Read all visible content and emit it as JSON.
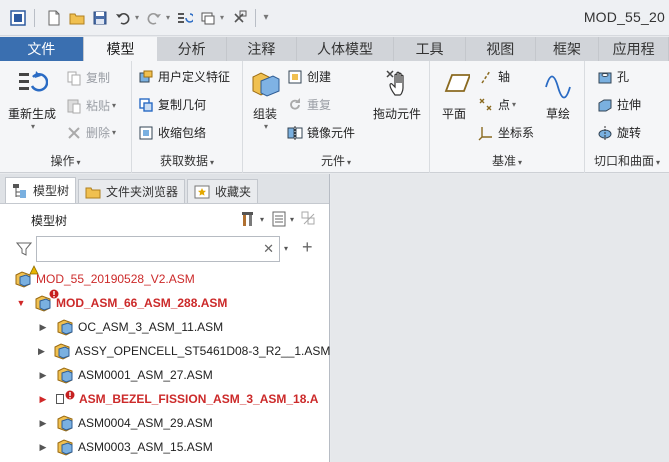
{
  "window": {
    "title": "MOD_55_20"
  },
  "tabs": [
    {
      "label": "文件",
      "w": 84
    },
    {
      "label": "模型",
      "w": 74
    },
    {
      "label": "分析",
      "w": 70
    },
    {
      "label": "注释",
      "w": 70
    },
    {
      "label": "人体模型",
      "w": 98
    },
    {
      "label": "工具",
      "w": 72
    },
    {
      "label": "视图",
      "w": 70
    },
    {
      "label": "框架",
      "w": 64
    },
    {
      "label": "应用程",
      "w": 70
    }
  ],
  "ribbon": {
    "operations": {
      "label": "操作",
      "regen": "重新生成",
      "copy": "复制",
      "paste": "粘贴",
      "delete": "删除"
    },
    "get_data": {
      "label": "获取数据",
      "udf": "用户定义特征",
      "copy_geom": "复制几何",
      "shrinkwrap": "收缩包络"
    },
    "component": {
      "label": "元件",
      "assemble": "组装",
      "create": "创建",
      "repeat": "重复",
      "mirror": "镜像元件",
      "drag": "拖动元件"
    },
    "datum": {
      "label": "基准",
      "plane": "平面",
      "axis": "轴",
      "point": "点",
      "csys": "坐标系",
      "sketch": "草绘"
    },
    "cut_surface": {
      "label": "切口和曲面",
      "hole": "孔",
      "extrude": "拉伸",
      "revolve": "旋转"
    }
  },
  "panel": {
    "tabs": [
      "模型树",
      "文件夹浏览器",
      "收藏夹"
    ],
    "tree_title": "模型树",
    "search": {
      "value": "",
      "placeholder": ""
    },
    "tree": {
      "root": "MOD_55_20190528_V2.ASM",
      "rows": [
        "MOD_ASM_66_ASM_288.ASM",
        "OC_ASM_3_ASM_11.ASM",
        "ASSY_OPENCELL_ST5461D08-3_R2__1.ASM",
        "ASM0001_ASM_27.ASM",
        "ASM_BEZEL_FISSION_ASM_3_ASM_18.A",
        "ASM0004_ASM_29.ASM",
        "ASM0003_ASM_15.ASM"
      ]
    }
  },
  "colors": {
    "file_tab": "#3a6fb0",
    "error_red": "#cc2a2a",
    "warning": "#e8b400"
  }
}
